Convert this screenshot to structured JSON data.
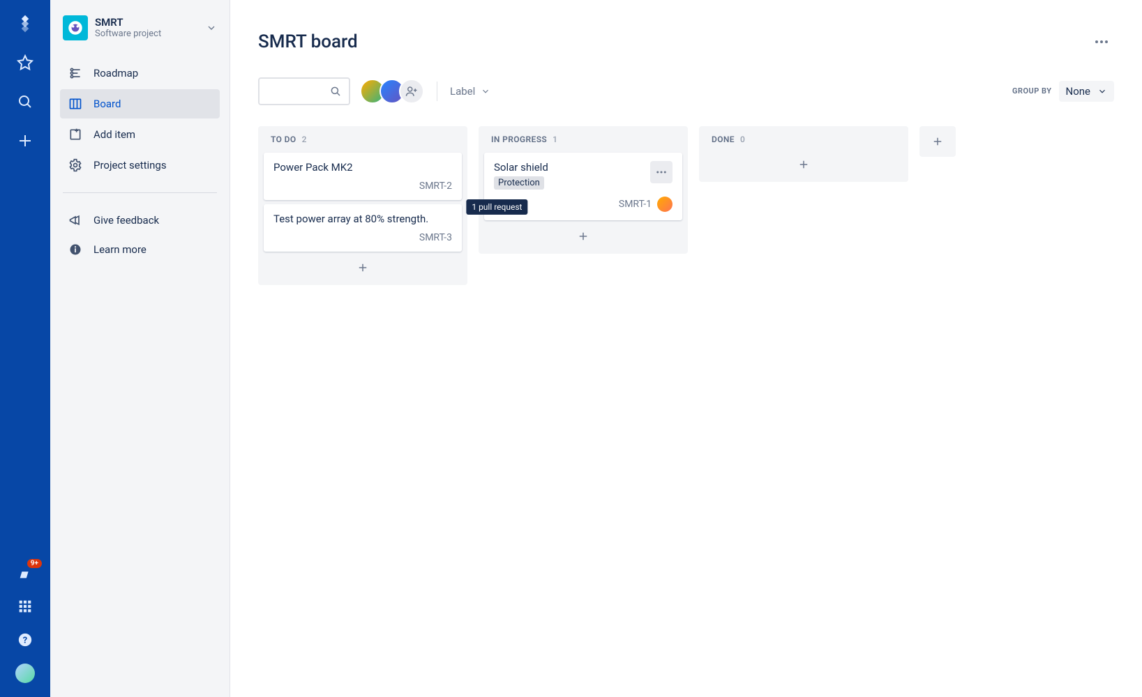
{
  "globalNav": {
    "notifBadge": "9+"
  },
  "project": {
    "name": "SMRT",
    "subtitle": "Software project",
    "items": [
      {
        "label": "Roadmap"
      },
      {
        "label": "Board"
      },
      {
        "label": "Add item"
      },
      {
        "label": "Project settings"
      }
    ],
    "feedback": "Give feedback",
    "learn": "Learn more"
  },
  "board": {
    "title": "SMRT board",
    "searchPlaceholder": "",
    "labelFilter": "Label",
    "groupByLabel": "GROUP BY",
    "groupByValue": "None",
    "columns": [
      {
        "name": "TO DO",
        "count": "2",
        "cards": [
          {
            "title": "Power Pack MK2",
            "key": "SMRT-2"
          },
          {
            "title": "Test power array at 80% strength.",
            "key": "SMRT-3"
          }
        ]
      },
      {
        "name": "IN PROGRESS",
        "count": "1",
        "cards": [
          {
            "title": "Solar shield",
            "tag": "Protection",
            "key": "SMRT-1",
            "prTooltip": "1 pull request",
            "assignee": true
          }
        ]
      },
      {
        "name": "DONE",
        "count": "0",
        "cards": []
      }
    ]
  }
}
